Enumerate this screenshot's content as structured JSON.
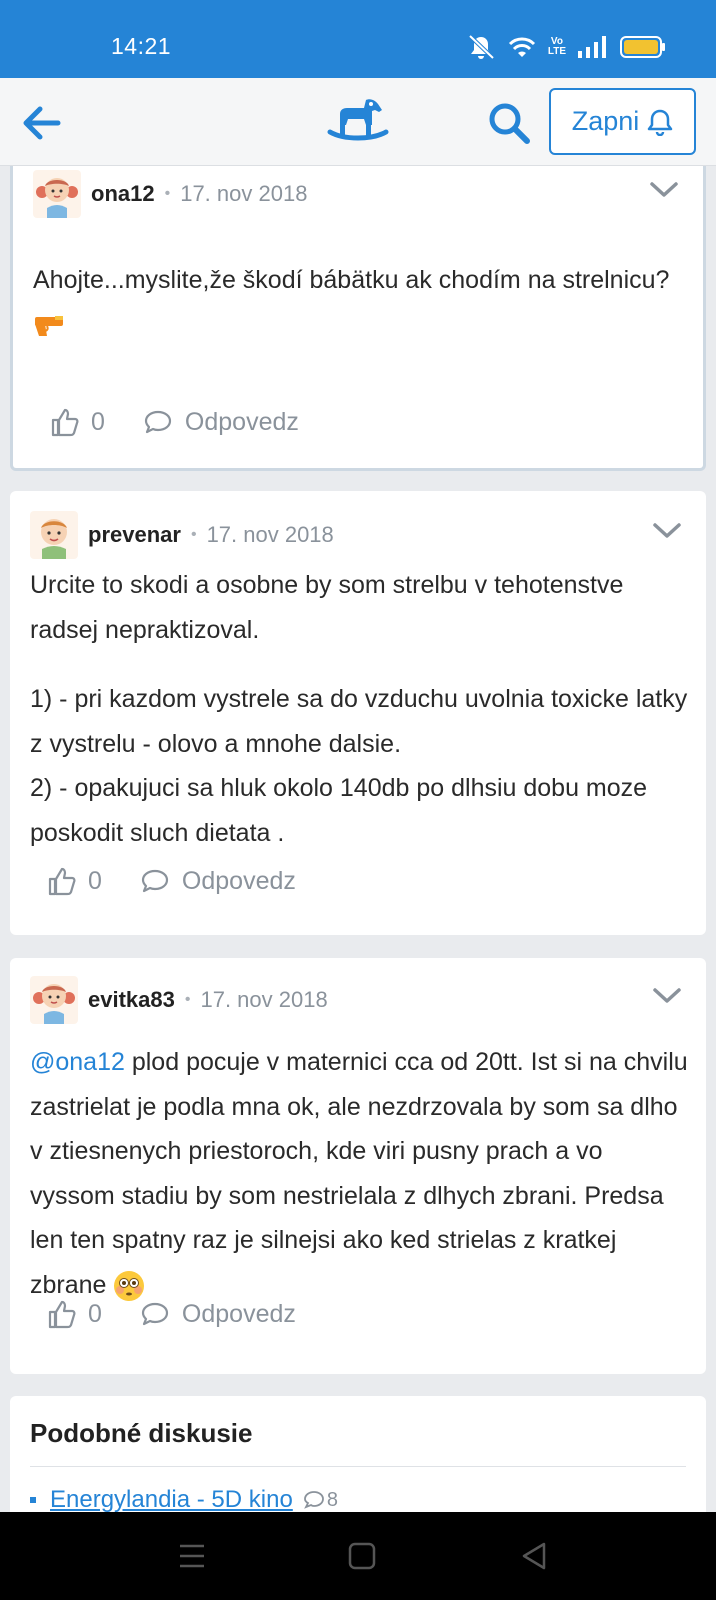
{
  "status_bar": {
    "time": "14:21",
    "net_label_top": "Vo",
    "net_label_bottom": "LTE"
  },
  "app_bar": {
    "zapni_label": "Zapni"
  },
  "posts": [
    {
      "author": "ona12",
      "date": "17. nov 2018",
      "paragraphs": [
        "Ahojte...myslite,že škodí bábätku ak chodím na strelnicu?"
      ],
      "likes": "0",
      "reply_label": "Odpovedz"
    },
    {
      "author": "prevenar",
      "date": "17. nov 2018",
      "paragraphs": [
        "Urcite to skodi a osobne by som strelbu v tehotenstve radsej nepraktizoval.",
        "1) - pri kazdom vystrele sa do vzduchu uvolnia toxicke latky z vystrelu - olovo a mnohe dalsie.",
        "2) - opakujuci sa hluk okolo 140db po dlhsiu dobu moze poskodit sluch dietata ."
      ],
      "likes": "0",
      "reply_label": "Odpovedz"
    },
    {
      "author": "evitka83",
      "date": "17. nov 2018",
      "mention": "@ona12",
      "paragraphs": [
        " plod pocuje v maternici cca od 20tt. Ist si na chvilu zastrielat je podla mna ok, ale nezdrzovala by som sa dlho v ztiesnenych priestoroch, kde viri pusny prach a vo vyssom stadiu by som nestrielala z dlhych zbrani. Predsa len ten spatny raz je silnejsi ako ked strielas z kratkej zbrane "
      ],
      "likes": "0",
      "reply_label": "Odpovedz"
    }
  ],
  "similar": {
    "title": "Podobné diskusie",
    "items": [
      {
        "label": "Energylandia - 5D kino",
        "count": "8"
      }
    ]
  }
}
